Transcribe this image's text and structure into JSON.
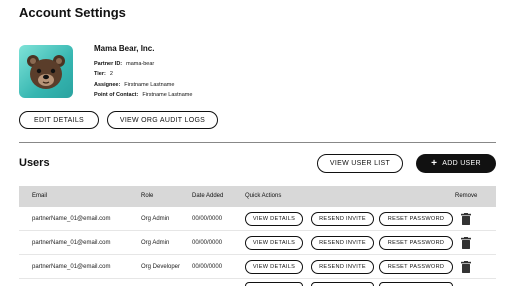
{
  "page": {
    "title": "Account Settings"
  },
  "org": {
    "name": "Mama Bear, Inc.",
    "fields": [
      {
        "key": "Partner ID:",
        "value": "mama-bear"
      },
      {
        "key": "Tier:",
        "value": "2"
      },
      {
        "key": "Assignee:",
        "value": "Firstname Lastname"
      },
      {
        "key": "Point of Contact:",
        "value": "Firstname Lastname"
      }
    ],
    "avatar_icon": "bear-face-icon",
    "avatar_colors": [
      "#7fe3d8",
      "#2aa3a0"
    ]
  },
  "actions": {
    "edit_details": "EDIT DETAILS",
    "view_audit_logs": "VIEW ORG AUDIT LOGS"
  },
  "users": {
    "title": "Users",
    "view_list": "VIEW USER LIST",
    "add_user_plus": "+",
    "add_user": "ADD USER",
    "columns": [
      "Email",
      "Role",
      "Date Added",
      "Quick Actions",
      "Remove"
    ],
    "rows": [
      {
        "email": "partnerName_01@email.com",
        "role": "Org Admin",
        "date": "00/00/0000"
      },
      {
        "email": "partnerName_01@email.com",
        "role": "Org Admin",
        "date": "00/00/0000"
      },
      {
        "email": "partnerName_01@email.com",
        "role": "Org Developer",
        "date": "00/00/0000"
      }
    ],
    "row_actions": {
      "view": "VIEW DETAILS",
      "resend": "RESEND INVITE",
      "reset": "RESET PASSWORD"
    },
    "remove_icon": "trash-icon"
  }
}
